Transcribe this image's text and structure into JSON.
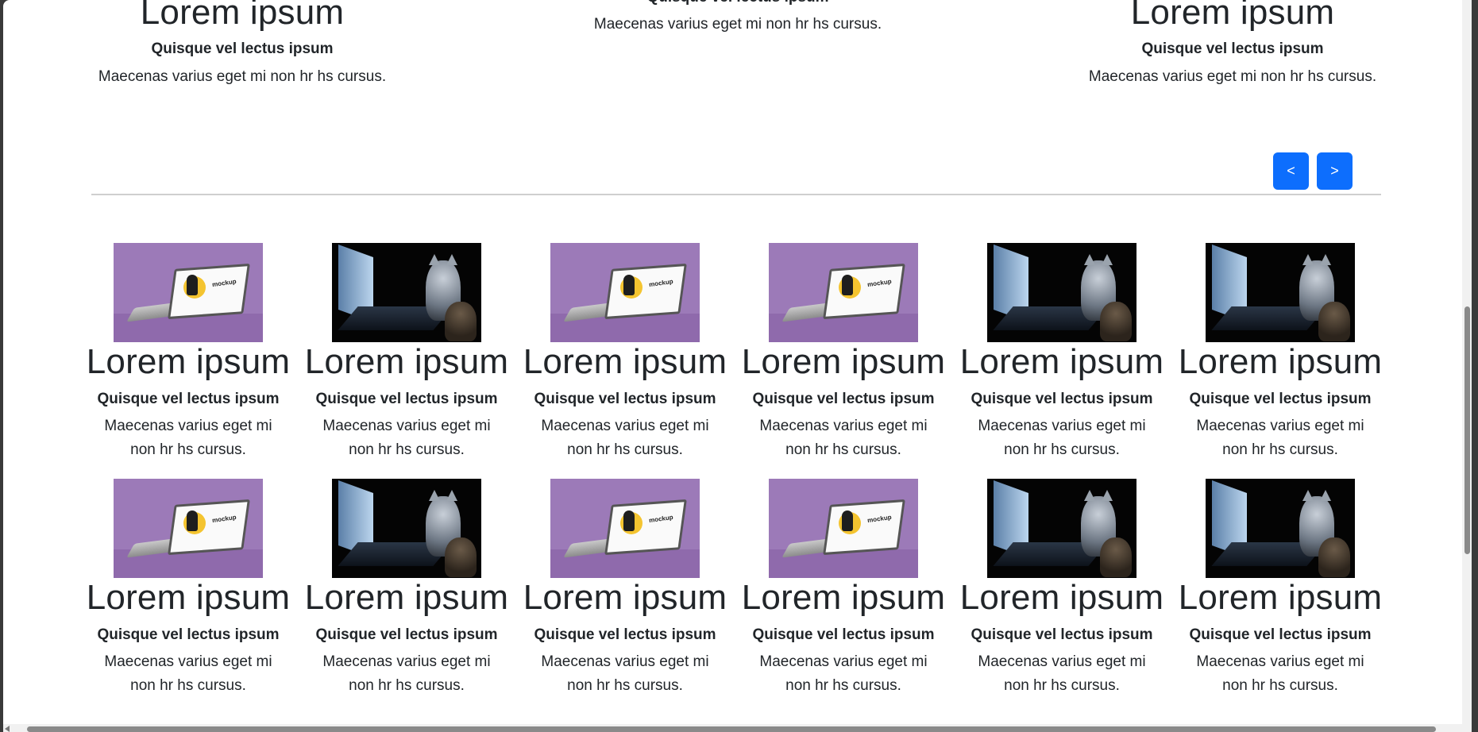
{
  "carousel": {
    "slides": [
      {
        "title": "Lorem ipsum",
        "subtitle": "Quisque vel lectus ipsum",
        "text": "Maecenas varius eget mi non hr hs cursus."
      },
      {
        "title": "",
        "subtitle": "Quisque vel lectus ipsum",
        "text": "Maecenas varius eget mi non hr hs cursus."
      },
      {
        "title": "Lorem ipsum",
        "subtitle": "Quisque vel lectus ipsum",
        "text": "Maecenas varius eget mi non hr hs cursus."
      }
    ],
    "prev_label": "<",
    "next_label": ">"
  },
  "grid": {
    "rows": [
      [
        {
          "image": "purple-laptop-mockup",
          "title": "Lorem ipsum",
          "subtitle": "Quisque vel lectus ipsum",
          "text": "Maecenas varius eget mi non hr hs cursus."
        },
        {
          "image": "cat-with-laptop",
          "title": "Lorem ipsum",
          "subtitle": "Quisque vel lectus ipsum",
          "text": "Maecenas varius eget mi non hr hs cursus."
        },
        {
          "image": "purple-laptop-mockup",
          "title": "Lorem ipsum",
          "subtitle": "Quisque vel lectus ipsum",
          "text": "Maecenas varius eget mi non hr hs cursus."
        },
        {
          "image": "purple-laptop-mockup",
          "title": "Lorem ipsum",
          "subtitle": "Quisque vel lectus ipsum",
          "text": "Maecenas varius eget mi non hr hs cursus."
        },
        {
          "image": "cat-with-laptop",
          "title": "Lorem ipsum",
          "subtitle": "Quisque vel lectus ipsum",
          "text": "Maecenas varius eget mi non hr hs cursus."
        },
        {
          "image": "cat-with-laptop",
          "title": "Lorem ipsum",
          "subtitle": "Quisque vel lectus ipsum",
          "text": "Maecenas varius eget mi non hr hs cursus."
        }
      ],
      [
        {
          "image": "purple-laptop-mockup",
          "title": "Lorem ipsum",
          "subtitle": "Quisque vel lectus ipsum",
          "text": "Maecenas varius eget mi non hr hs cursus."
        },
        {
          "image": "cat-with-laptop",
          "title": "Lorem ipsum",
          "subtitle": "Quisque vel lectus ipsum",
          "text": "Maecenas varius eget mi non hr hs cursus."
        },
        {
          "image": "purple-laptop-mockup",
          "title": "Lorem ipsum",
          "subtitle": "Quisque vel lectus ipsum",
          "text": "Maecenas varius eget mi non hr hs cursus."
        },
        {
          "image": "purple-laptop-mockup",
          "title": "Lorem ipsum",
          "subtitle": "Quisque vel lectus ipsum",
          "text": "Maecenas varius eget mi non hr hs cursus."
        },
        {
          "image": "cat-with-laptop",
          "title": "Lorem ipsum",
          "subtitle": "Quisque vel lectus ipsum",
          "text": "Maecenas varius eget mi non hr hs cursus."
        },
        {
          "image": "cat-with-laptop",
          "title": "Lorem ipsum",
          "subtitle": "Quisque vel lectus ipsum",
          "text": "Maecenas varius eget mi non hr hs cursus."
        }
      ]
    ]
  },
  "colors": {
    "accent": "#0d6efd",
    "text": "#212529",
    "mockup_bg": "#9c7ab8"
  }
}
